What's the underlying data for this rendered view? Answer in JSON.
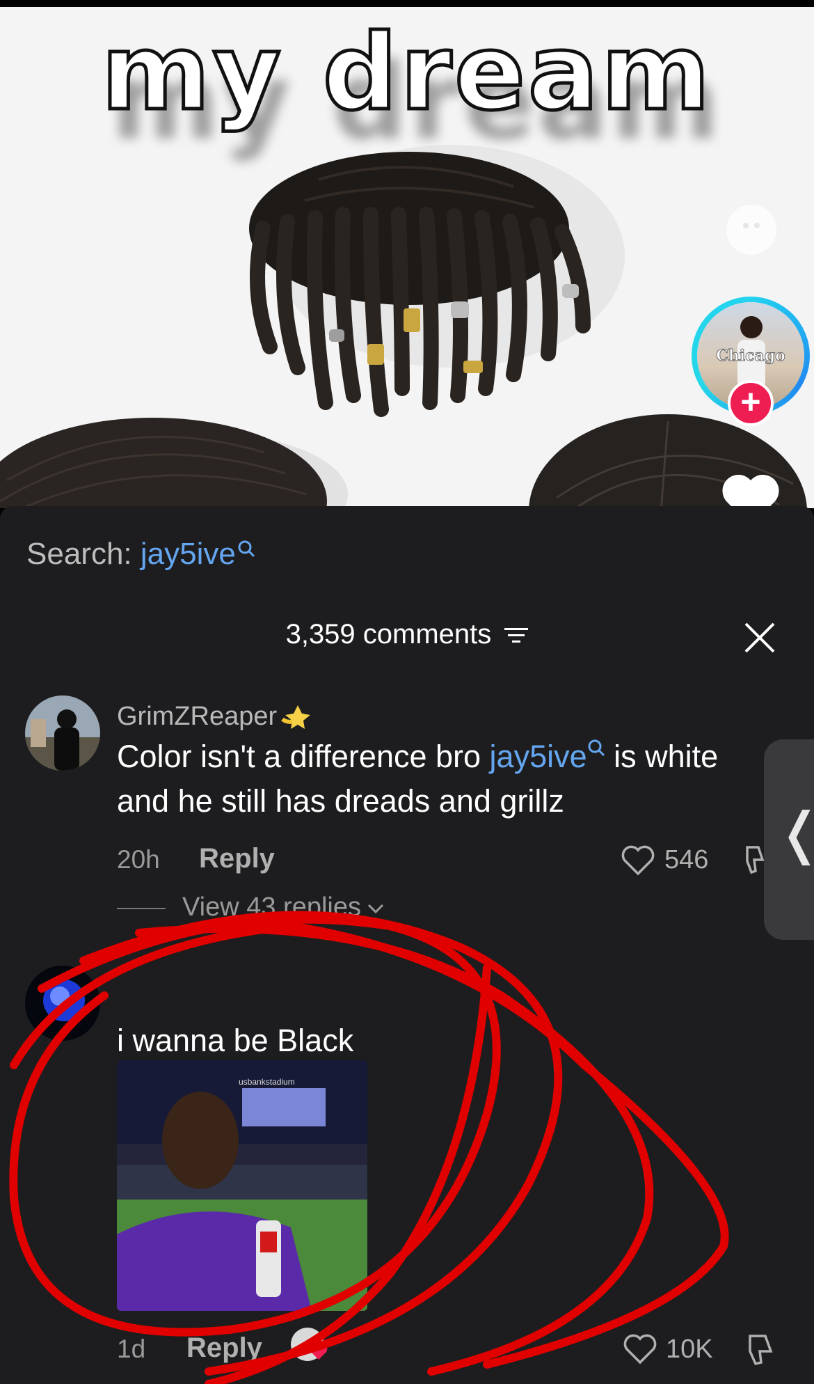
{
  "video": {
    "overlay_title": "my dream",
    "creator_avatar_caption": "Chicago"
  },
  "search": {
    "label": "Search:",
    "term": "jay5ive"
  },
  "comments_header": {
    "count_text": "3,359 comments"
  },
  "comments": [
    {
      "username": "GrimZReaper",
      "text_before": "Color isn't a difference bro ",
      "mention": "jay5ive",
      "text_after": " is white and he still has dreads and grillz",
      "time": "20h",
      "reply_label": "Reply",
      "likes": "546",
      "view_replies": "View 43 replies"
    },
    {
      "username": "",
      "text": "i wanna be Black",
      "gif_text": "usbankstadium",
      "time": "1d",
      "reply_label": "Reply",
      "likes": "10K"
    }
  ],
  "side_tab": {
    "glyph": "❬"
  },
  "colors": {
    "sheet_bg": "#1d1d1f",
    "mention_blue": "#64a6f0",
    "scribble_red": "#e00000",
    "follow_pink": "#ee1d52"
  }
}
